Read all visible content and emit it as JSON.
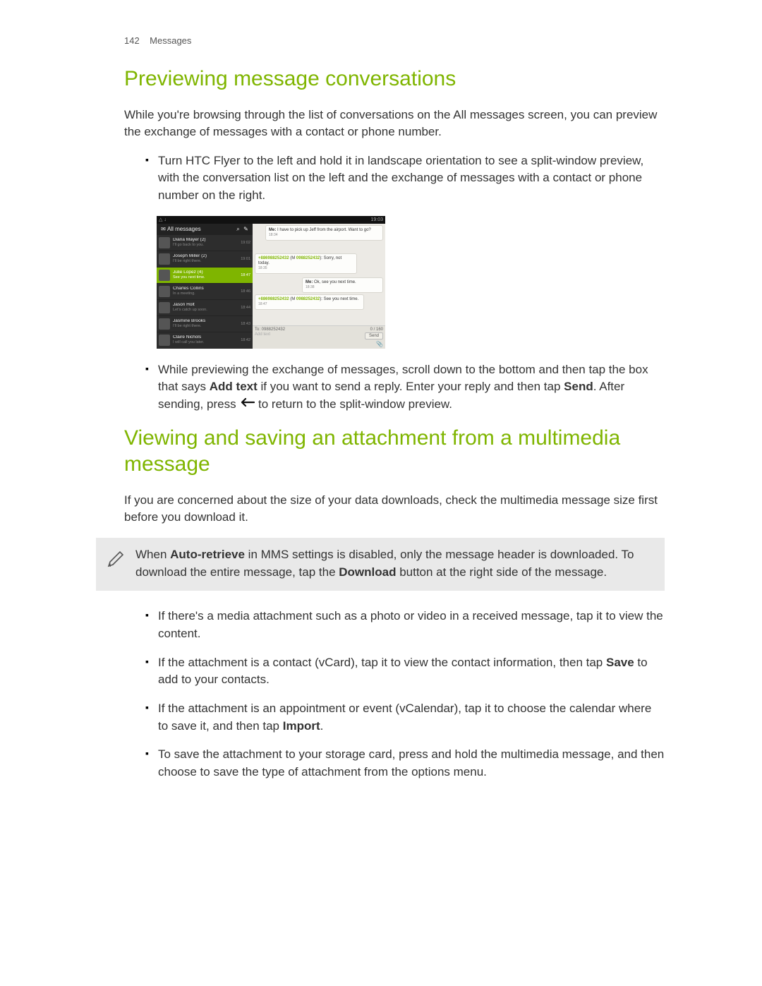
{
  "header": {
    "page_no": "142",
    "section": "Messages"
  },
  "h1a": "Previewing message conversations",
  "p1": "While you're browsing through the list of conversations on the All messages screen, you can preview the exchange of messages with a contact or phone number.",
  "bullets_a": [
    "Turn HTC Flyer to the left and hold it in landscape orientation to see a split-window preview, with the conversation list on the left and the exchange of messages with a contact or phone number on the right."
  ],
  "bullet_a2": {
    "pre": "While previewing the exchange of messages, scroll down to the bottom and then tap the box that says ",
    "b1": "Add text",
    "mid1": " if you want to send a reply. Enter your reply and then tap ",
    "b2": "Send",
    "mid2": ". After sending, press ",
    "post": " to return to the split-window preview."
  },
  "h1b": "Viewing and saving an attachment from a multimedia message",
  "p2": "If you are concerned about the size of your data downloads, check the multimedia message size first before you download it.",
  "note": {
    "pre": "When ",
    "b1": "Auto-retrieve",
    "mid": " in MMS settings is disabled, only the message header is downloaded. To download the entire message, tap the ",
    "b2": "Download",
    "post": " button at the right side of the message."
  },
  "bullets_b": [
    {
      "text": "If there's a media attachment such as a photo or video in a received message, tap it to view the content."
    },
    {
      "pre": "If the attachment is a contact (vCard), tap it to view the contact information, then tap ",
      "b": "Save",
      "post": " to add to your contacts."
    },
    {
      "pre": "If the attachment is an appointment or event (vCalendar), tap it to choose the calendar where to save it, and then tap ",
      "b": "Import",
      "post": "."
    },
    {
      "text": "To save the attachment to your storage card, press and hold the multimedia message, and then choose to save the type of attachment from the options menu."
    }
  ],
  "shot": {
    "status_left": "△ ↓",
    "status_right": "19:03",
    "hdr": "All messages",
    "rows": [
      {
        "name": "Diana Mayer (2)",
        "sub": "I'll go back to you.",
        "time": "19:02"
      },
      {
        "name": "Joseph Miller (2)",
        "sub": "I'll be right there.",
        "time": "19:01"
      },
      {
        "name": "Julie Lopez (4)",
        "sub": "See you next time.",
        "time": "18:47",
        "sel": true
      },
      {
        "name": "Charles Collins",
        "sub": "In a meeting.",
        "time": "18:46"
      },
      {
        "name": "Jason Holt",
        "sub": "Let's catch up soon.",
        "time": "18:44"
      },
      {
        "name": "Jasmine Brooks",
        "sub": "I'll be right there.",
        "time": "18:43"
      },
      {
        "name": "Claire Nichols",
        "sub": "I will call you later.",
        "time": "18:42"
      }
    ],
    "msgs": {
      "m1_pre": "Me:",
      "m1": " I have to pick up Jeff from the airport. Want to go?",
      "m1t": "18:34",
      "m2_ph1": "+886988252432",
      "m2_mid": " (M ",
      "m2_ph2": "0988252432",
      "m2_txt": "): Sorry, not today.",
      "m2t": "18:35",
      "m3_pre": "Me:",
      "m3": " Ok, see you next time.",
      "m3t": "18:38",
      "m4_ph1": "+886988252432",
      "m4_mid": " (M ",
      "m4_ph2": "0988252432",
      "m4_txt": "): See you next time.",
      "m4t": "18:47"
    },
    "compose": {
      "to": "To: 0988252432",
      "counter": "0 / 160",
      "placeholder": "Add text",
      "send": "Send"
    }
  }
}
